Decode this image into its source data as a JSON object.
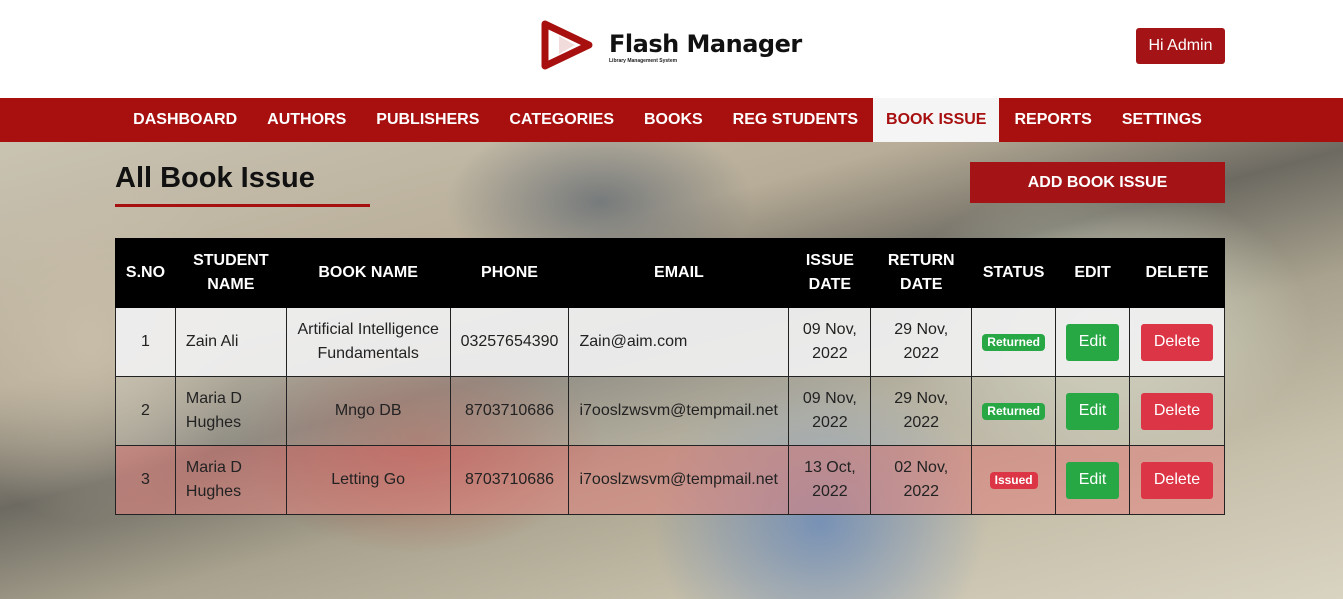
{
  "brand": {
    "title": "Flash Manager",
    "subtitle": "Library Management System",
    "logo_icon": "play-logo-icon",
    "accent": "#a81010"
  },
  "header": {
    "admin_label": "Hi Admin"
  },
  "nav": [
    {
      "label": "DASHBOARD",
      "active": false
    },
    {
      "label": "AUTHORS",
      "active": false
    },
    {
      "label": "PUBLISHERS",
      "active": false
    },
    {
      "label": "CATEGORIES",
      "active": false
    },
    {
      "label": "BOOKS",
      "active": false
    },
    {
      "label": "REG STUDENTS",
      "active": false
    },
    {
      "label": "BOOK ISSUE",
      "active": true
    },
    {
      "label": "REPORTS",
      "active": false
    },
    {
      "label": "SETTINGS",
      "active": false
    }
  ],
  "main": {
    "title": "All Book Issue",
    "add_label": "ADD BOOK ISSUE"
  },
  "table": {
    "headers": [
      [
        "S.NO"
      ],
      [
        "STUDENT",
        "NAME"
      ],
      [
        "BOOK NAME"
      ],
      [
        "PHONE"
      ],
      [
        "EMAIL"
      ],
      [
        "ISSUE",
        "DATE"
      ],
      [
        "RETURN",
        "DATE"
      ],
      [
        "STATUS"
      ],
      [
        "EDIT"
      ],
      [
        "DELETE"
      ]
    ],
    "rows": [
      {
        "sno": "1",
        "student": [
          "Zain Ali"
        ],
        "book": [
          "Artificial Intelligence",
          "Fundamentals"
        ],
        "phone": "03257654390",
        "email": "Zain@aim.com",
        "issue": [
          "09 Nov,",
          "2022"
        ],
        "return": [
          "29 Nov,",
          "2022"
        ],
        "status": "Returned",
        "edit": "Edit",
        "delete": "Delete"
      },
      {
        "sno": "2",
        "student": [
          "Maria D",
          "Hughes"
        ],
        "book": [
          "Mngo DB"
        ],
        "phone": "8703710686",
        "email": "i7ooslzwsvm@tempmail.net",
        "issue": [
          "09 Nov,",
          "2022"
        ],
        "return": [
          "29 Nov,",
          "2022"
        ],
        "status": "Returned",
        "edit": "Edit",
        "delete": "Delete"
      },
      {
        "sno": "3",
        "student": [
          "Maria D",
          "Hughes"
        ],
        "book": [
          "Letting Go"
        ],
        "phone": "8703710686",
        "email": "i7ooslzwsvm@tempmail.net",
        "issue": [
          "13 Oct,",
          "2022"
        ],
        "return": [
          "02 Nov,",
          "2022"
        ],
        "status": "Issued",
        "edit": "Edit",
        "delete": "Delete"
      }
    ]
  }
}
